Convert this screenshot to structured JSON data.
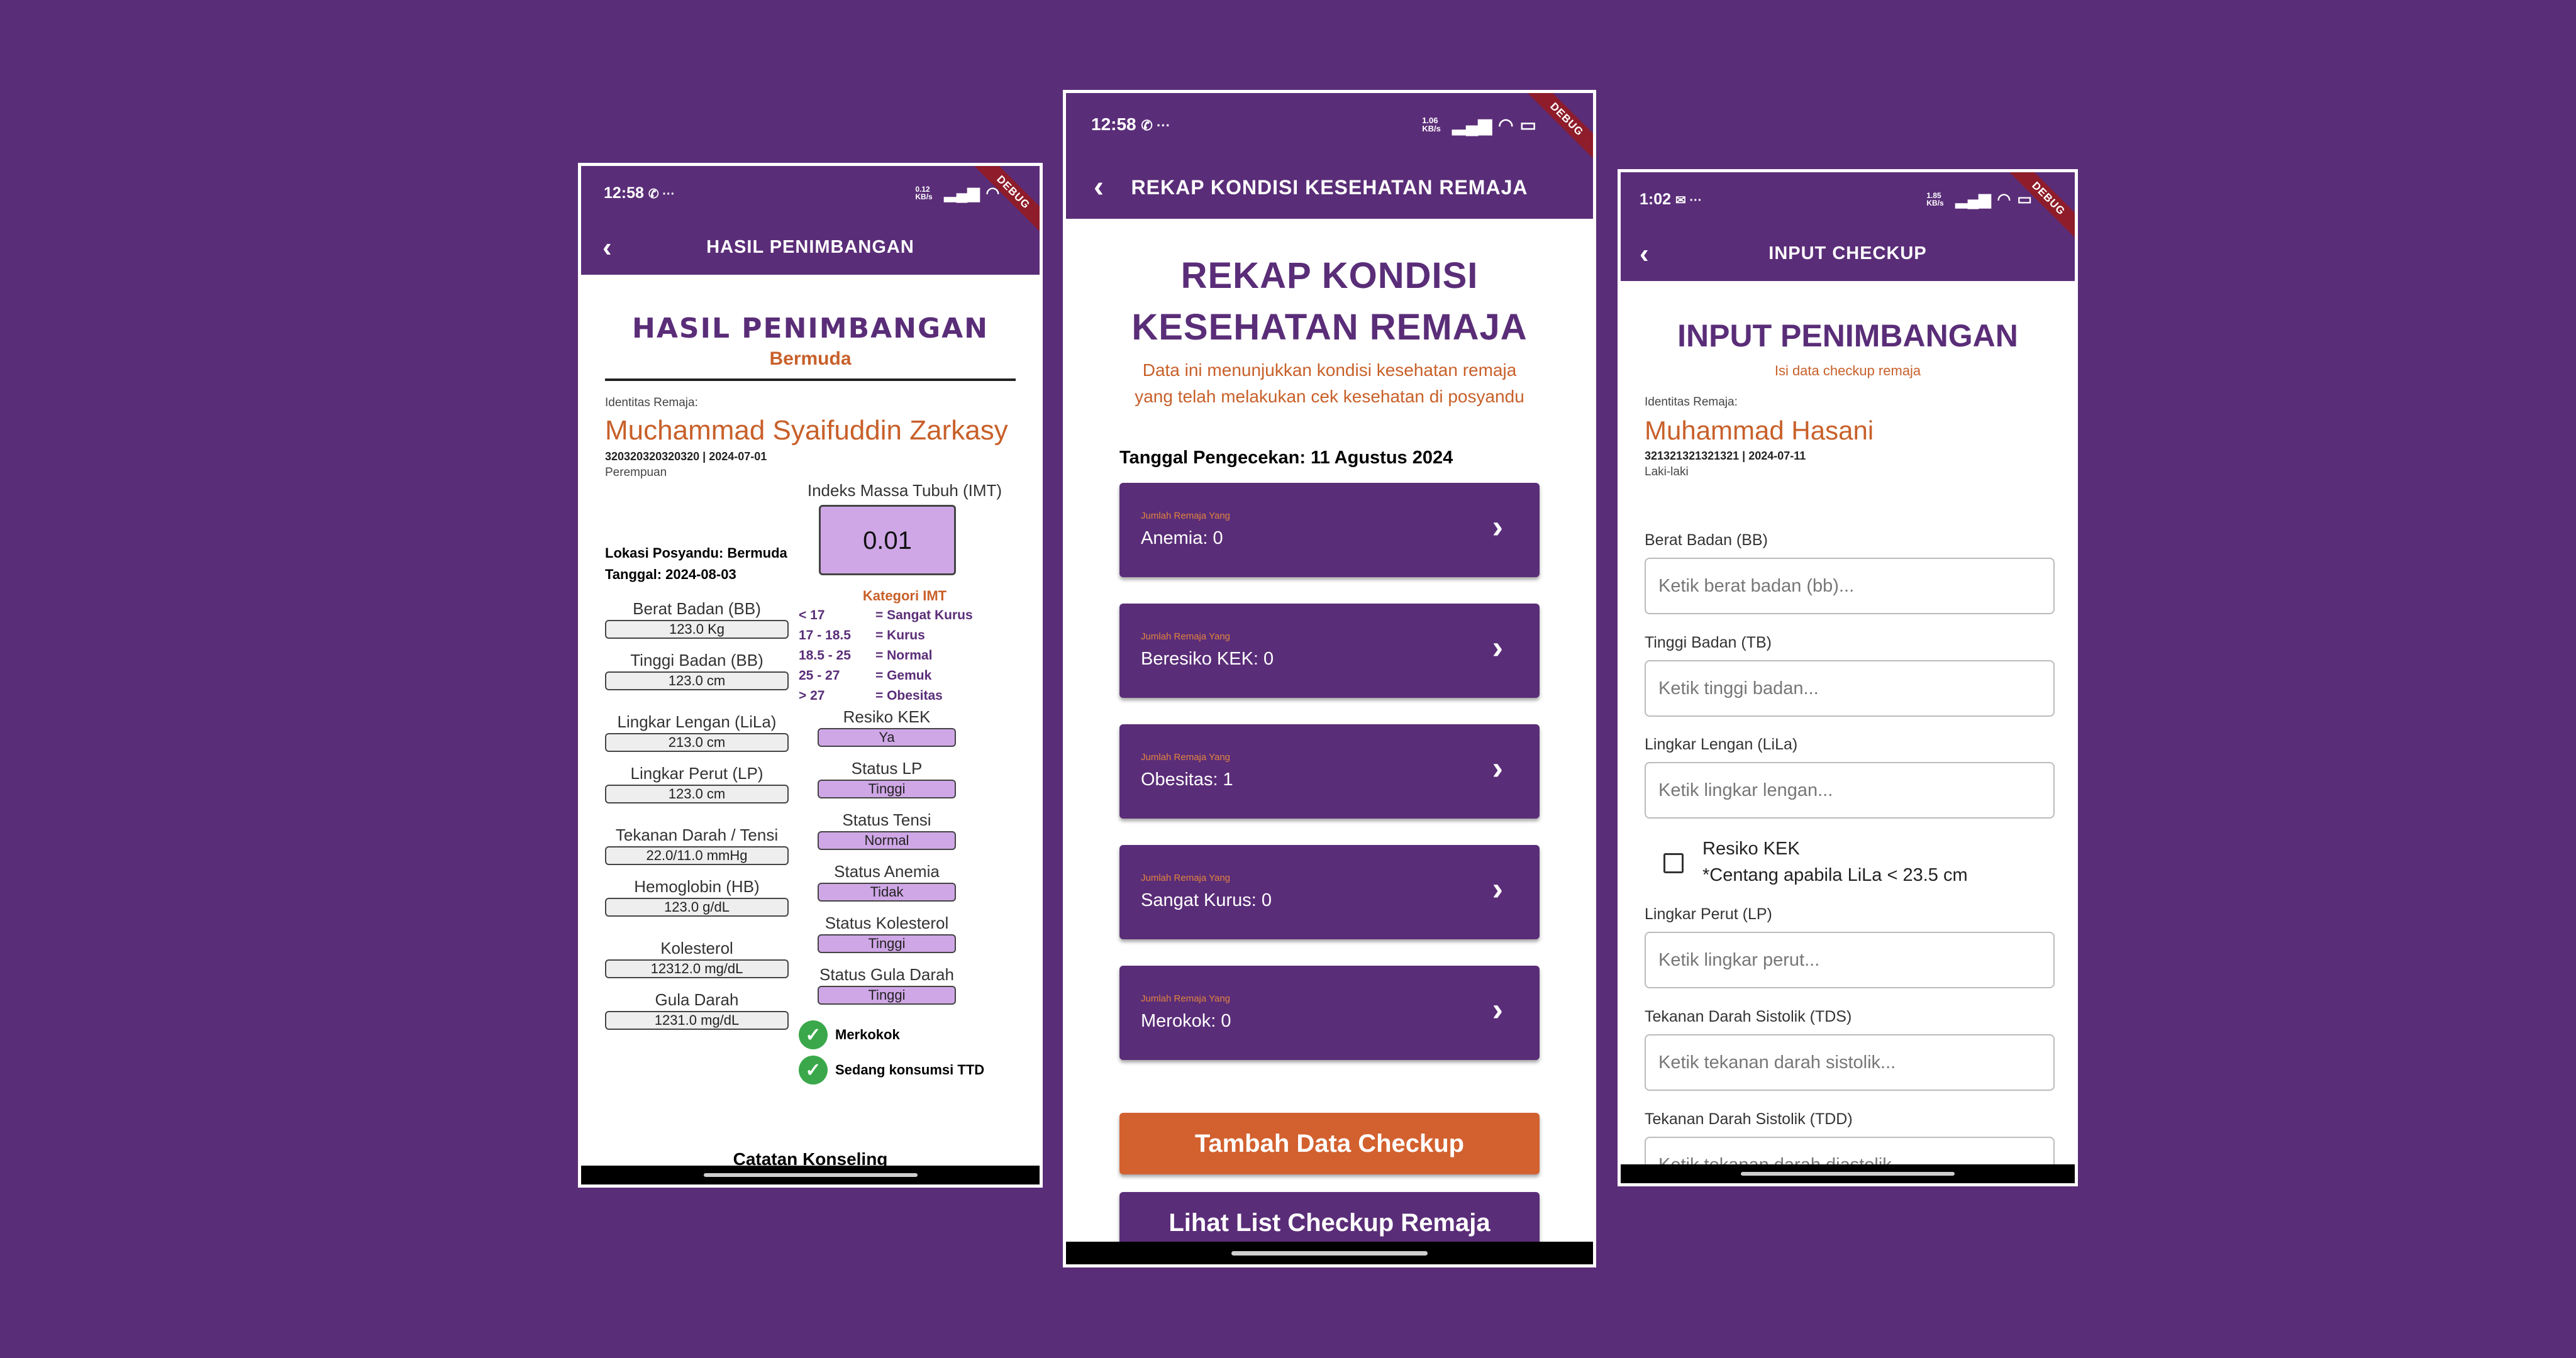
{
  "phone1": {
    "status": {
      "time": "12:58",
      "icons": "✆ ···",
      "right": "0.12 KB/s"
    },
    "appbar": {
      "title": "HASIL PENIMBANGAN"
    },
    "debug": "DEBUG",
    "heading": "HASIL PENIMBANGAN",
    "subheading": "Bermuda",
    "identity_label": "Identitas Remaja:",
    "name": "Muchammad Syaifuddin Zarkasy",
    "id_line": "320320320320320 | 2024-07-01",
    "gender": "Perempuan",
    "lokasi": "Lokasi Posyandu: Bermuda",
    "tanggal": "Tanggal: 2024-08-03",
    "left_fields": [
      {
        "label": "Berat Badan (BB)",
        "value": "123.0 Kg"
      },
      {
        "label": "Tinggi Badan (BB)",
        "value": "123.0 cm"
      },
      {
        "label": "Lingkar Lengan (LiLa)",
        "value": "213.0 cm"
      },
      {
        "label": "Lingkar Perut (LP)",
        "value": "123.0 cm"
      },
      {
        "label": "Tekanan Darah / Tensi",
        "value": "22.0/11.0 mmHg"
      },
      {
        "label": "Hemoglobin (HB)",
        "value": "123.0 g/dL"
      },
      {
        "label": "Kolesterol",
        "value": "12312.0 mg/dL"
      },
      {
        "label": "Gula Darah",
        "value": "1231.0 mg/dL"
      }
    ],
    "imt_label": "Indeks Massa Tubuh (IMT)",
    "imt_value": "0.01",
    "kategori_label": "Kategori IMT",
    "kategori": [
      {
        "range": "< 17",
        "desc": "= Sangat Kurus"
      },
      {
        "range": "17 - 18.5",
        "desc": "= Kurus"
      },
      {
        "range": "18.5 - 25",
        "desc": "= Normal"
      },
      {
        "range": "25 - 27",
        "desc": "= Gemuk"
      },
      {
        "range": "> 27",
        "desc": "= Obesitas"
      }
    ],
    "right_fields": [
      {
        "label": "Resiko KEK",
        "value": "Ya"
      },
      {
        "label": "Status LP",
        "value": "Tinggi"
      },
      {
        "label": "Status Tensi",
        "value": "Normal"
      },
      {
        "label": "Status Anemia",
        "value": "Tidak"
      },
      {
        "label": "Status Kolesterol",
        "value": "Tinggi"
      },
      {
        "label": "Status Gula Darah",
        "value": "Tinggi"
      }
    ],
    "checks": [
      "Merkokok",
      "Sedang konsumsi TTD"
    ],
    "catatan": "Catatan Konseling"
  },
  "phone2": {
    "status": {
      "time": "12:58",
      "icons": "✆ ···",
      "right": "1.06 KB/s"
    },
    "appbar": {
      "title": "REKAP KONDISI KESEHATAN REMAJA"
    },
    "debug": "DEBUG",
    "heading_line1": "REKAP KONDISI",
    "heading_line2": "KESEHATAN REMAJA",
    "desc_line1": "Data ini menunjukkan kondisi kesehatan remaja",
    "desc_line2": "yang telah melakukan cek kesehatan di posyandu",
    "tanggal": "Tanggal Pengecekan: 11 Agustus 2024",
    "cards": [
      {
        "caption": "Jumlah Remaja Yang",
        "value": "Anemia: 0"
      },
      {
        "caption": "Jumlah Remaja Yang",
        "value": "Beresiko KEK: 0"
      },
      {
        "caption": "Jumlah Remaja Yang",
        "value": "Obesitas: 1"
      },
      {
        "caption": "Jumlah Remaja Yang",
        "value": "Sangat Kurus: 0"
      },
      {
        "caption": "Jumlah Remaja Yang",
        "value": "Merokok: 0"
      }
    ],
    "btn_tambah": "Tambah Data Checkup",
    "btn_lihat": "Lihat List Checkup Remaja",
    "colors": {
      "orange": "#d2612f",
      "purple": "#5a2d78"
    }
  },
  "phone3": {
    "status": {
      "time": "1:02",
      "icons": "✉ ···",
      "right": "1.85 KB/s"
    },
    "appbar": {
      "title": "INPUT CHECKUP"
    },
    "debug": "DEBUG",
    "heading": "INPUT PENIMBANGAN",
    "subheading": "Isi data checkup remaja",
    "identity_label": "Identitas Remaja:",
    "name": "Muhammad Hasani",
    "id_line": "321321321321321 | 2024-07-11",
    "gender": "Laki-laki",
    "fields": [
      {
        "label": "Berat Badan (BB)",
        "placeholder": "Ketik berat badan (bb)..."
      },
      {
        "label": "Tinggi Badan (TB)",
        "placeholder": "Ketik tinggi badan..."
      },
      {
        "label": "Lingkar Lengan (LiLa)",
        "placeholder": "Ketik lingkar lengan..."
      }
    ],
    "kek_line1": "Resiko KEK",
    "kek_line2": "*Centang apabila LiLa < 23.5 cm",
    "fields2": [
      {
        "label": "Lingkar Perut (LP)",
        "placeholder": "Ketik lingkar perut..."
      },
      {
        "label": "Tekanan Darah Sistolik (TDS)",
        "placeholder": "Ketik tekanan darah sistolik..."
      },
      {
        "label": "Tekanan Darah Sistolik (TDD)",
        "placeholder": "Ketik tekanan darah diastolik..."
      }
    ]
  }
}
